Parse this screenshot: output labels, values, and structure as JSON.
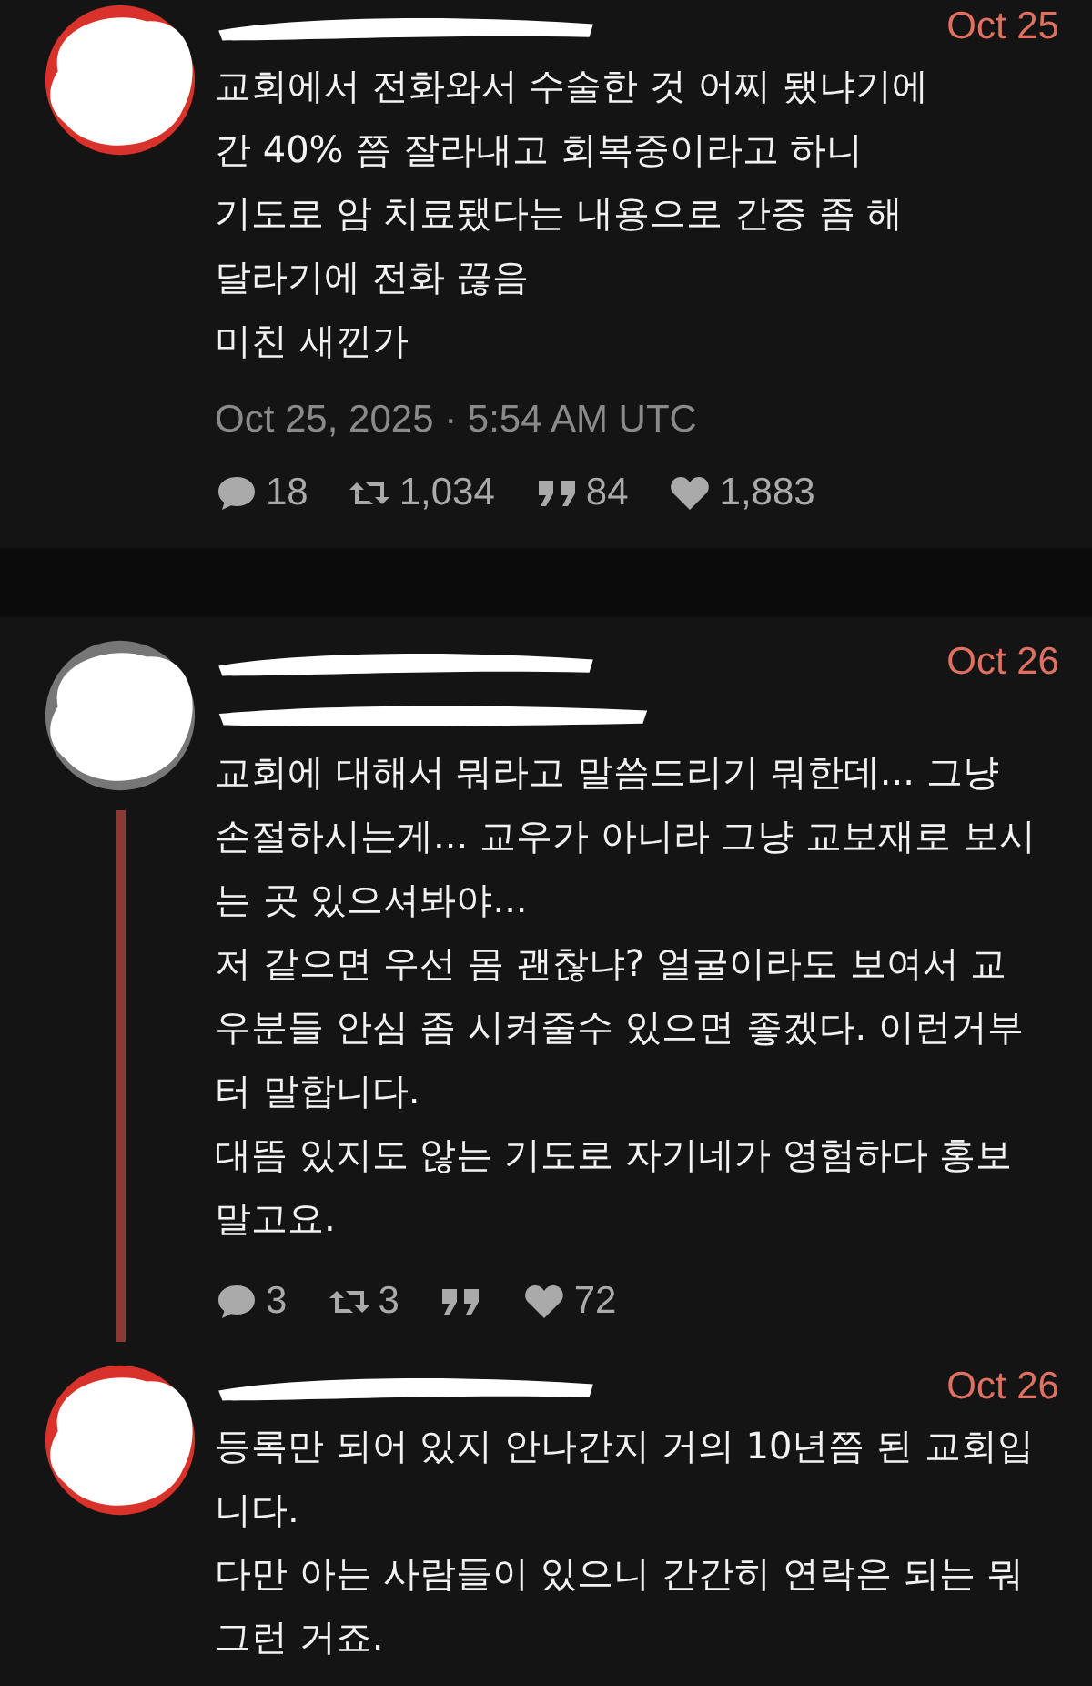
{
  "posts": [
    {
      "date": "Oct 25",
      "reply_line": false,
      "thread_line": false,
      "lines": [
        "교회에서 전화와서 수술한 것 어찌 됐냐기에",
        "간 40% 쯤 잘라내고 회복중이라고 하니",
        "기도로 암 치료됐다는 내용으로 간증 좀 해",
        "달라기에 전화 끊음",
        "미친 새낀가"
      ],
      "timestamp": "Oct 25, 2025 · 5:54 AM UTC",
      "stats": [
        {
          "kind": "reply",
          "count": "18"
        },
        {
          "kind": "retweet",
          "count": "1,034"
        },
        {
          "kind": "quote",
          "count": "84"
        },
        {
          "kind": "like",
          "count": "1,883"
        }
      ]
    },
    {
      "date": "Oct 26",
      "reply_line": true,
      "thread_line": true,
      "lines": [
        "교회에 대해서 뭐라고 말씀드리기 뭐한데... 그냥",
        "손절하시는게... 교우가 아니라 그냥 교보재로 보시",
        "는 곳 있으셔봐야...",
        "저 같으면 우선 몸 괜찮냐? 얼굴이라도 보여서 교",
        "우분들 안심 좀 시켜줄수 있으면 좋겠다. 이런거부",
        "터 말합니다.",
        "대뜸 있지도 않는 기도로 자기네가 영험하다 홍보",
        "말고요."
      ],
      "stats": [
        {
          "kind": "reply",
          "count": "3"
        },
        {
          "kind": "retweet",
          "count": "3"
        },
        {
          "kind": "quote"
        },
        {
          "kind": "like",
          "count": "72"
        }
      ]
    },
    {
      "date": "Oct 26",
      "reply_line": false,
      "thread_line": false,
      "lines": [
        "등록만 되어 있지 안나간지 거의 10년쯤 된 교회입",
        "니다.",
        "다만 아는 사람들이 있으니 간간히 연락은 되는 뭐",
        "그런 거죠."
      ]
    }
  ]
}
